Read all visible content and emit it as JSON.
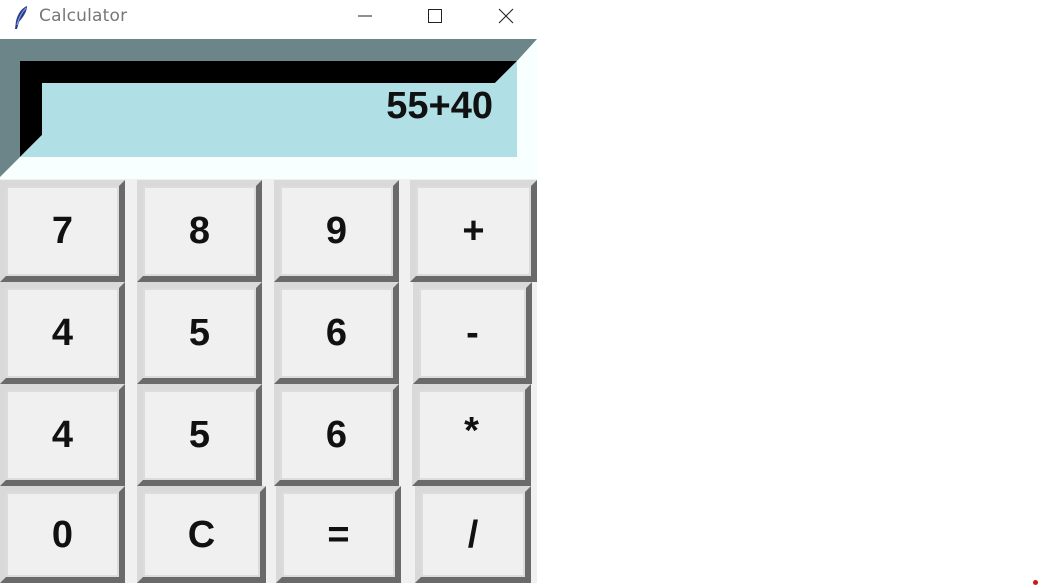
{
  "window": {
    "title": "Calculator",
    "icons": {
      "app": "feather-icon",
      "minimize": "minimize-icon",
      "maximize": "maximize-icon",
      "close": "close-icon"
    }
  },
  "display": {
    "value": "55+40"
  },
  "keys": [
    [
      "7",
      "8",
      "9",
      "+"
    ],
    [
      "4",
      "5",
      "6",
      "-"
    ],
    [
      "4",
      "5",
      "6",
      "*"
    ],
    [
      "0",
      "C",
      "=",
      "/"
    ]
  ],
  "colors": {
    "display_bg": "#b0e0e6",
    "display_frame_dark": "#000000",
    "display_frame_shade": "#6b8588",
    "key_face": "#f0f0f0",
    "key_shadow": "#6a6a6a",
    "key_highlight": "#d9d9d9"
  }
}
